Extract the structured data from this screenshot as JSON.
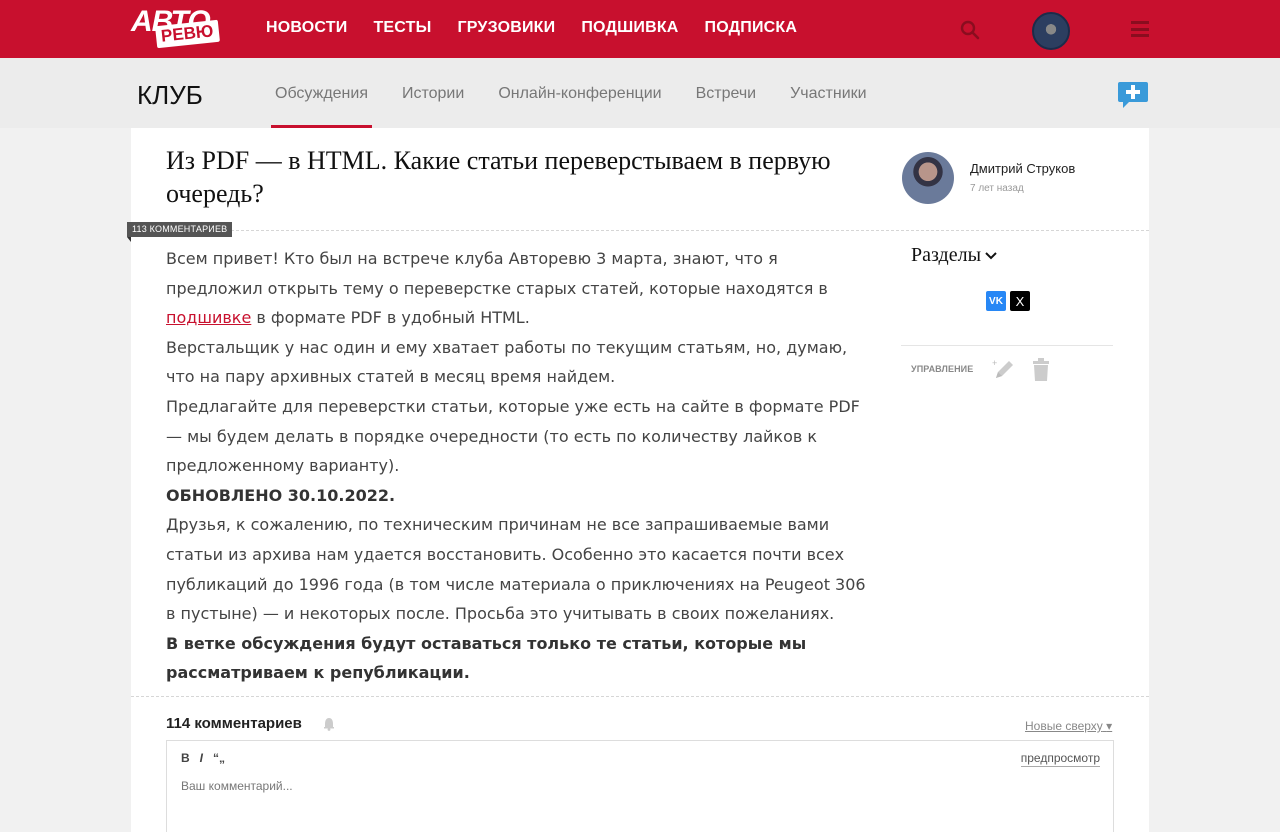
{
  "header": {
    "logo_top": "АВТО",
    "logo_bottom": "РЕВЮ",
    "nav": [
      "НОВОСТИ",
      "ТЕСТЫ",
      "ГРУЗОВИКИ",
      "ПОДШИВКА",
      "ПОДПИСКА"
    ],
    "icons": [
      "search-icon",
      "user-avatar",
      "menu-icon"
    ]
  },
  "club": {
    "title": "КЛУБ",
    "tabs": [
      "Обсуждения",
      "Истории",
      "Онлайн-конференции",
      "Встречи",
      "Участники"
    ],
    "active_tab": "Обсуждения"
  },
  "post": {
    "title": "Из PDF — в HTML. Какие статьи переверстываем в первую очередь?",
    "comments_badge": "113 КОММЕНТАРИЕВ",
    "author": "Дмитрий Струков",
    "time": "7 лет назад",
    "p1_before_link": "Всем привет! Кто был на встрече клуба Авторевю 3 марта, знают, что я предложил открыть тему о переверстке старых статей, которые находятся в ",
    "p1_link": "подшивке",
    "p1_after_link": " в формате PDF в удобный HTML.",
    "p2": "Верстальщик у нас один и ему хватает работы по текущим статьям, но, думаю, что на пару архивных статей в месяц время найдем.",
    "p3": "Предлагайте для переверстки статьи, которые уже есть на сайте в формате PDF — мы будем делать в порядке очередности (то есть по количеству лайков к предложенному варианту).",
    "p4": "ОБНОВЛЕНО 30.10.2022.",
    "p5": "Друзья, к сожалению, по техническим причинам не все запрашиваемые вами статьи из архива нам удается восстановить. Особенно это касается почти всех публикаций до 1996 года (в том числе материала о приключениях на Peugeot 306 в пустыне) — и некоторых после. Просьба это учитывать в своих пожеланиях.",
    "p6": "В ветке обсуждения будут оставаться только те статьи, которые мы рассматриваем к републикации."
  },
  "sidebar": {
    "sections": "Разделы",
    "share_vk": "VK",
    "share_x": "X",
    "manage": "УПРАВЛЕНИЕ"
  },
  "comments": {
    "count": "114 комментариев",
    "sort": "Новые сверху",
    "bold": "B",
    "italic": "I",
    "quote": "“„",
    "preview": "предпросмотр",
    "placeholder": "Ваш комментарий..."
  },
  "colors": {
    "brand": "#c8102e",
    "link": "#c8102e",
    "vk": "#2787f5"
  }
}
